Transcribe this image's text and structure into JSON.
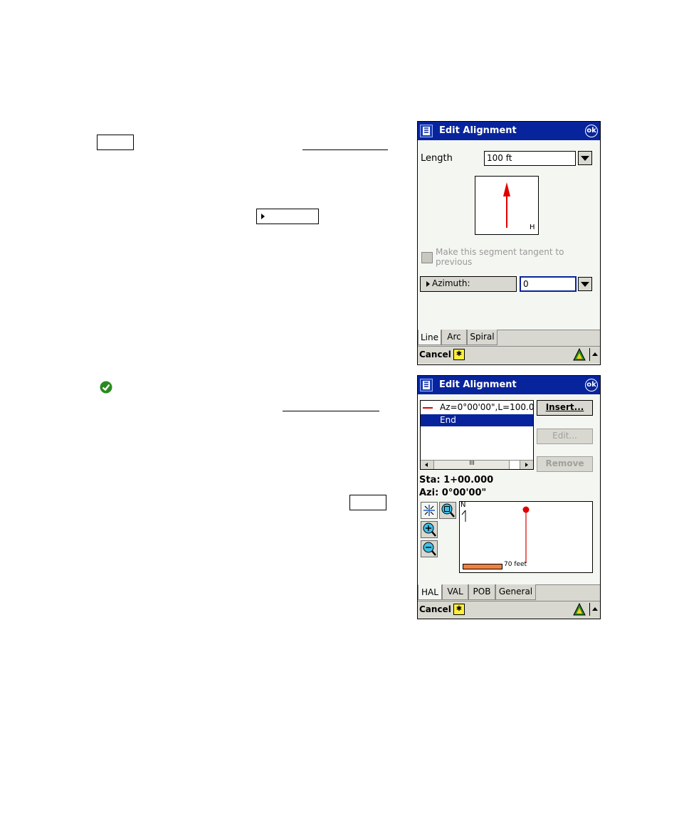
{
  "screen1": {
    "title": "Edit Alignment",
    "ok_label": "ok",
    "length_label": "Length",
    "length_value": "100 ft",
    "preview_label": "H",
    "tangent_checkbox_label": "Make this segment tangent to previous",
    "azimuth_label": "Azimuth:",
    "azimuth_value": "0",
    "tabs": [
      "Line",
      "Arc",
      "Spiral"
    ],
    "cancel_label": "Cancel"
  },
  "screen2": {
    "title": "Edit Alignment",
    "ok_label": "ok",
    "list_items": [
      "Az=0°00'00\",L=100.0",
      "End"
    ],
    "insert_label": "Insert...",
    "edit_label": "Edit...",
    "remove_label": "Remove",
    "scroll_mid": "III",
    "station_text": "Sta: 1+00.000",
    "azimuth_text": "Azi: 0°00'00\"",
    "north_label": "N",
    "scale_label": "70 feet",
    "tabs": [
      "HAL",
      "VAL",
      "POB",
      "General"
    ],
    "cancel_label": "Cancel"
  },
  "colors": {
    "titlebar": "#08249c",
    "alignment_line": "#e00000",
    "scale_bar": "#f08040",
    "selection": "#08249c"
  }
}
